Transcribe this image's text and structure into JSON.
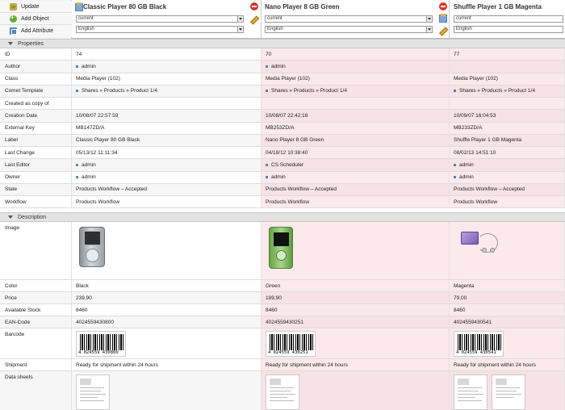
{
  "toolbar": {
    "update_label": "Update",
    "add_object_label": "Add Object",
    "add_attribute_label": "Add Attribute"
  },
  "columns": [
    {
      "title": "Classic Player 80 GB Black",
      "version": "current",
      "language": "English"
    },
    {
      "title": "Nano Player 8 GB Green",
      "version": "current",
      "language": "English"
    },
    {
      "title": "Shuffle Player 1 GB Magenta",
      "version": "current",
      "language": "English"
    }
  ],
  "sections": {
    "properties": "Properties",
    "description": "Description"
  },
  "properties": [
    {
      "label": "ID",
      "values": [
        "74",
        "70",
        "77"
      ],
      "bullet": false
    },
    {
      "label": "Author",
      "values": [
        "admin",
        "admin",
        ""
      ],
      "bullet": true
    },
    {
      "label": "Class",
      "values": [
        "Media Player (102)",
        "Media Player (102)",
        "Media Player (102)"
      ],
      "bullet": false
    },
    {
      "label": "Comet Template",
      "values": [
        "Shares » Products » Product 1/4",
        "Shares » Products » Product 1/4",
        "Shares » Products » Product 1/4"
      ],
      "bullet": true
    },
    {
      "label": "Created as copy of",
      "values": [
        "",
        "",
        ""
      ],
      "bullet": false
    },
    {
      "label": "Creation Date",
      "values": [
        "10/08/07 22:57:59",
        "10/08/07 22:42:16",
        "10/09/07 16:04:53"
      ],
      "bullet": false
    },
    {
      "label": "External Key",
      "values": [
        "MB147ZD/A",
        "MB253ZD/A",
        "MB233ZD/A"
      ],
      "bullet": false
    },
    {
      "label": "Label",
      "values": [
        "Classic Player 80 GB Black",
        "Nano Player 8 GB Green",
        "Shuffle Player 1 GB Magenta"
      ],
      "bullet": false
    },
    {
      "label": "Last Change",
      "values": [
        "05/13/12 11:11:34",
        "04/18/12 10:38:40",
        "08/02/13 14:51:10"
      ],
      "bullet": false
    },
    {
      "label": "Last Editor",
      "values": [
        "admin",
        "CS Scheduler",
        "admin"
      ],
      "bullet": true
    },
    {
      "label": "Owner",
      "values": [
        "admin",
        "admin",
        "admin"
      ],
      "bullet": true
    },
    {
      "label": "State",
      "values": [
        "Products Workflow – Accepted",
        "Products Workflow – Accepted",
        "Products Workflow – Accepted"
      ],
      "bullet": false
    },
    {
      "label": "Workflow",
      "values": [
        "Products Workflow",
        "Products Workflow",
        "Products Workflow"
      ],
      "bullet": false
    }
  ],
  "description": {
    "image_label": "Image",
    "color_label": "Color",
    "colors": [
      "Black",
      "Green",
      "Magenta"
    ],
    "price_label": "Price",
    "prices": [
      "239,90",
      "189,90",
      "79,00"
    ],
    "stock_label": "Available Stock",
    "stocks": [
      "8460",
      "8460",
      "8460"
    ],
    "ean_label": "EAN-Code",
    "eans": [
      "4024559430800",
      "4024559430251",
      "4024559430541"
    ],
    "barcode_label": "Barcode",
    "barcode_texts": [
      "4 024559 430800",
      "4 024559 430251",
      "4 024559 430541"
    ],
    "shipment_label": "Shipment",
    "shipments": [
      "Ready for shipment within 24 hours",
      "Ready for shipment within 24 hours",
      "Ready for shipment within 24 hours"
    ],
    "datasheets_label": "Data sheets"
  }
}
